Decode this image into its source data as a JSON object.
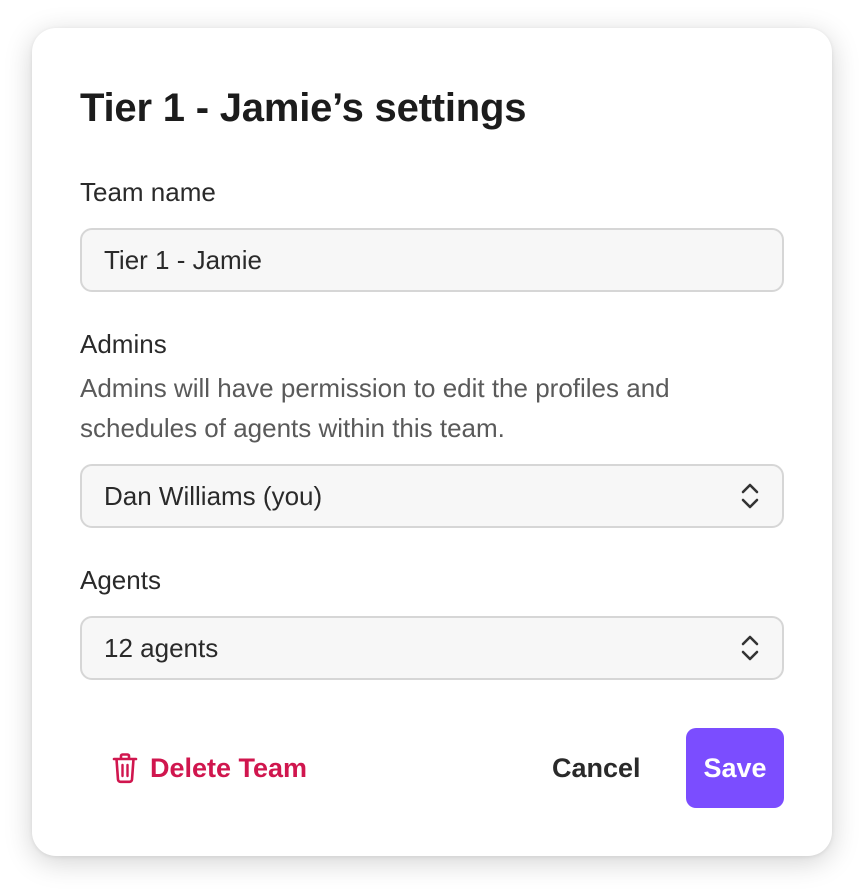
{
  "dialog": {
    "title": "Tier 1 - Jamie’s settings",
    "team_name": {
      "label": "Team name",
      "value": "Tier 1 - Jamie"
    },
    "admins": {
      "label": "Admins",
      "description": "Admins will have permission to edit the profiles and schedules of agents within this team.",
      "selected": "Dan Williams (you)"
    },
    "agents": {
      "label": "Agents",
      "selected": "12 agents"
    },
    "footer": {
      "delete_label": "Delete Team",
      "cancel_label": "Cancel",
      "save_label": "Save"
    },
    "icons": {
      "delete": "trash-icon",
      "select": "chevron-up-down-icon"
    },
    "colors": {
      "accent": "#7b4dff",
      "danger": "#d0164e"
    }
  }
}
